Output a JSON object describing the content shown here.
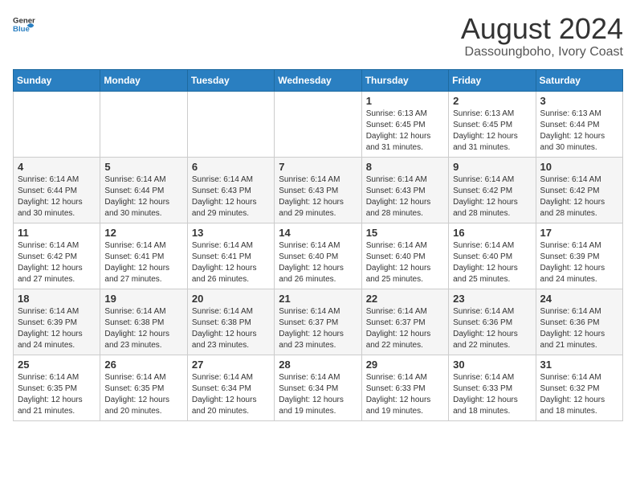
{
  "logo": {
    "general": "General",
    "blue": "Blue"
  },
  "title": {
    "month": "August 2024",
    "location": "Dassoungboho, Ivory Coast"
  },
  "weekdays": [
    "Sunday",
    "Monday",
    "Tuesday",
    "Wednesday",
    "Thursday",
    "Friday",
    "Saturday"
  ],
  "weeks": [
    [
      {
        "day": "",
        "info": ""
      },
      {
        "day": "",
        "info": ""
      },
      {
        "day": "",
        "info": ""
      },
      {
        "day": "",
        "info": ""
      },
      {
        "day": "1",
        "info": "Sunrise: 6:13 AM\nSunset: 6:45 PM\nDaylight: 12 hours\nand 31 minutes."
      },
      {
        "day": "2",
        "info": "Sunrise: 6:13 AM\nSunset: 6:45 PM\nDaylight: 12 hours\nand 31 minutes."
      },
      {
        "day": "3",
        "info": "Sunrise: 6:13 AM\nSunset: 6:44 PM\nDaylight: 12 hours\nand 30 minutes."
      }
    ],
    [
      {
        "day": "4",
        "info": "Sunrise: 6:14 AM\nSunset: 6:44 PM\nDaylight: 12 hours\nand 30 minutes."
      },
      {
        "day": "5",
        "info": "Sunrise: 6:14 AM\nSunset: 6:44 PM\nDaylight: 12 hours\nand 30 minutes."
      },
      {
        "day": "6",
        "info": "Sunrise: 6:14 AM\nSunset: 6:43 PM\nDaylight: 12 hours\nand 29 minutes."
      },
      {
        "day": "7",
        "info": "Sunrise: 6:14 AM\nSunset: 6:43 PM\nDaylight: 12 hours\nand 29 minutes."
      },
      {
        "day": "8",
        "info": "Sunrise: 6:14 AM\nSunset: 6:43 PM\nDaylight: 12 hours\nand 28 minutes."
      },
      {
        "day": "9",
        "info": "Sunrise: 6:14 AM\nSunset: 6:42 PM\nDaylight: 12 hours\nand 28 minutes."
      },
      {
        "day": "10",
        "info": "Sunrise: 6:14 AM\nSunset: 6:42 PM\nDaylight: 12 hours\nand 28 minutes."
      }
    ],
    [
      {
        "day": "11",
        "info": "Sunrise: 6:14 AM\nSunset: 6:42 PM\nDaylight: 12 hours\nand 27 minutes."
      },
      {
        "day": "12",
        "info": "Sunrise: 6:14 AM\nSunset: 6:41 PM\nDaylight: 12 hours\nand 27 minutes."
      },
      {
        "day": "13",
        "info": "Sunrise: 6:14 AM\nSunset: 6:41 PM\nDaylight: 12 hours\nand 26 minutes."
      },
      {
        "day": "14",
        "info": "Sunrise: 6:14 AM\nSunset: 6:40 PM\nDaylight: 12 hours\nand 26 minutes."
      },
      {
        "day": "15",
        "info": "Sunrise: 6:14 AM\nSunset: 6:40 PM\nDaylight: 12 hours\nand 25 minutes."
      },
      {
        "day": "16",
        "info": "Sunrise: 6:14 AM\nSunset: 6:40 PM\nDaylight: 12 hours\nand 25 minutes."
      },
      {
        "day": "17",
        "info": "Sunrise: 6:14 AM\nSunset: 6:39 PM\nDaylight: 12 hours\nand 24 minutes."
      }
    ],
    [
      {
        "day": "18",
        "info": "Sunrise: 6:14 AM\nSunset: 6:39 PM\nDaylight: 12 hours\nand 24 minutes."
      },
      {
        "day": "19",
        "info": "Sunrise: 6:14 AM\nSunset: 6:38 PM\nDaylight: 12 hours\nand 23 minutes."
      },
      {
        "day": "20",
        "info": "Sunrise: 6:14 AM\nSunset: 6:38 PM\nDaylight: 12 hours\nand 23 minutes."
      },
      {
        "day": "21",
        "info": "Sunrise: 6:14 AM\nSunset: 6:37 PM\nDaylight: 12 hours\nand 23 minutes."
      },
      {
        "day": "22",
        "info": "Sunrise: 6:14 AM\nSunset: 6:37 PM\nDaylight: 12 hours\nand 22 minutes."
      },
      {
        "day": "23",
        "info": "Sunrise: 6:14 AM\nSunset: 6:36 PM\nDaylight: 12 hours\nand 22 minutes."
      },
      {
        "day": "24",
        "info": "Sunrise: 6:14 AM\nSunset: 6:36 PM\nDaylight: 12 hours\nand 21 minutes."
      }
    ],
    [
      {
        "day": "25",
        "info": "Sunrise: 6:14 AM\nSunset: 6:35 PM\nDaylight: 12 hours\nand 21 minutes."
      },
      {
        "day": "26",
        "info": "Sunrise: 6:14 AM\nSunset: 6:35 PM\nDaylight: 12 hours\nand 20 minutes."
      },
      {
        "day": "27",
        "info": "Sunrise: 6:14 AM\nSunset: 6:34 PM\nDaylight: 12 hours\nand 20 minutes."
      },
      {
        "day": "28",
        "info": "Sunrise: 6:14 AM\nSunset: 6:34 PM\nDaylight: 12 hours\nand 19 minutes."
      },
      {
        "day": "29",
        "info": "Sunrise: 6:14 AM\nSunset: 6:33 PM\nDaylight: 12 hours\nand 19 minutes."
      },
      {
        "day": "30",
        "info": "Sunrise: 6:14 AM\nSunset: 6:33 PM\nDaylight: 12 hours\nand 18 minutes."
      },
      {
        "day": "31",
        "info": "Sunrise: 6:14 AM\nSunset: 6:32 PM\nDaylight: 12 hours\nand 18 minutes."
      }
    ]
  ]
}
